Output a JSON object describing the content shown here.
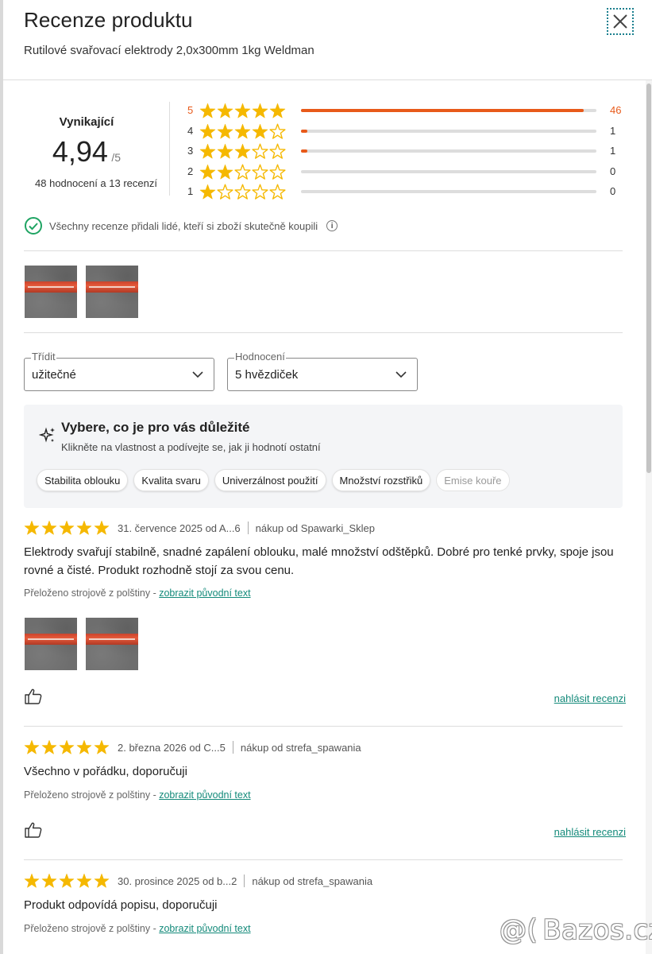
{
  "header": {
    "title": "Recenze produktu",
    "subtitle": "Rutilové svařovací elektrody 2,0x300mm 1kg Weldman"
  },
  "summary": {
    "rating_word": "Vynikající",
    "score": "4,94",
    "score_max": "/5",
    "counts": "48 hodnocení a 13 recenzí"
  },
  "distribution": [
    {
      "stars": "5",
      "count": "46",
      "fraction": 0.958,
      "highlight": true
    },
    {
      "stars": "4",
      "count": "1",
      "fraction": 0.021,
      "highlight": false
    },
    {
      "stars": "3",
      "count": "1",
      "fraction": 0.021,
      "highlight": false
    },
    {
      "stars": "2",
      "count": "0",
      "fraction": 0,
      "highlight": false
    },
    {
      "stars": "1",
      "count": "0",
      "fraction": 0,
      "highlight": false
    }
  ],
  "verified_note": "Všechny recenze přidali lidé, kteří si zboží skutečně koupili",
  "filters": {
    "sort": {
      "label": "Třídit",
      "value": "užitečné"
    },
    "rating": {
      "label": "Hodnocení",
      "value": "5 hvězdiček"
    }
  },
  "topics": {
    "title": "Vybere, co je pro vás důležité",
    "subtitle": "Klikněte na vlastnost a podívejte se, jak ji hodnotí ostatní",
    "chips": [
      "Stabilita oblouku",
      "Kvalita svaru",
      "Univerzálnost použití",
      "Množství rozstřiků",
      "Emise kouře"
    ]
  },
  "reviews": [
    {
      "rating": 5,
      "date": "31. července 2025 od A...6",
      "seller": "nákup od Spawarki_Sklep",
      "text": "Elektrody svařují stabilně, snadné zapálení oblouku, malé množství odštěpků. Dobré pro tenké prvky, spoje jsou rovné a čisté. Produkt rozhodně stojí za svou cenu.",
      "translated": "Přeloženo strojově z polštiny -",
      "show_original": "zobrazit původní text",
      "report": "nahlásit recenzi"
    },
    {
      "rating": 5,
      "date": "2. března 2026 od C...5",
      "seller": "nákup od strefa_spawania",
      "text": "Všechno v pořádku, doporučuji",
      "translated": "Přeloženo strojově z polštiny -",
      "show_original": "zobrazit původní text",
      "report": "nahlásit recenzi"
    },
    {
      "rating": 5,
      "date": "30. prosince 2025 od b...2",
      "seller": "nákup od strefa_spawania",
      "text": "Produkt odpovídá popisu, doporučuji",
      "translated": "Přeloženo strojově z polštiny -",
      "show_original": "zobrazit původní text"
    }
  ],
  "watermark": {
    "at": "@(",
    "text": "Bazos.cz"
  },
  "colors": {
    "accent": "#e85a1a",
    "star": "#f5b800",
    "link": "#138a7a",
    "check": "#1fa463"
  },
  "icons": [
    "close-icon",
    "star-icon",
    "check-circle-icon",
    "info-icon",
    "sparkle-icon",
    "chevron-down-icon",
    "thumbs-up-icon"
  ]
}
